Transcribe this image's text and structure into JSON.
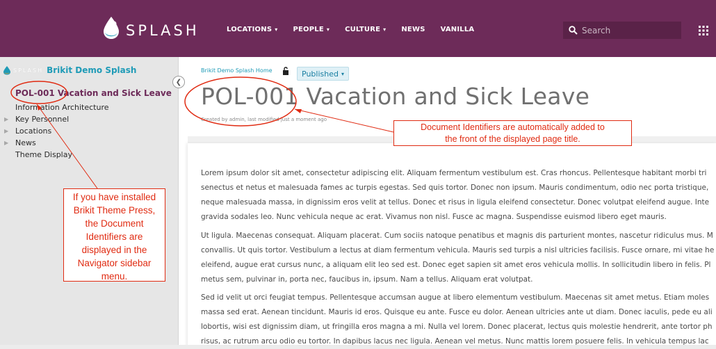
{
  "header": {
    "brand": "SPLASH",
    "nav": [
      {
        "label": "LOCATIONS",
        "dropdown": true
      },
      {
        "label": "PEOPLE",
        "dropdown": true
      },
      {
        "label": "CULTURE",
        "dropdown": true
      },
      {
        "label": "NEWS",
        "dropdown": false
      },
      {
        "label": "VANILLA",
        "dropdown": false
      }
    ],
    "search_placeholder": "Search"
  },
  "sidebar": {
    "mini_brand": "SPLASH",
    "site_name": "Brikit Demo Splash",
    "items": [
      {
        "label": "POL-001 Vacation and Sick Leave",
        "current": true,
        "expandable": false
      },
      {
        "label": "Information Architecture",
        "current": false,
        "expandable": false
      },
      {
        "label": "Key Personnel",
        "current": false,
        "expandable": true
      },
      {
        "label": "Locations",
        "current": false,
        "expandable": true
      },
      {
        "label": "News",
        "current": false,
        "expandable": true
      },
      {
        "label": "Theme Display",
        "current": false,
        "expandable": false
      }
    ]
  },
  "page": {
    "breadcrumb": "Brikit Demo Splash Home",
    "status": "Published",
    "title": "POL-001 Vacation and Sick Leave",
    "modified": "Created by admin, last modified just a moment ago",
    "paragraphs": [
      [
        "Lorem ipsum dolor sit amet, consectetur adipiscing elit. Aliquam fermentum vestibulum est. Cras rhoncus. Pellentesque habitant morbi tri",
        "senectus et netus et malesuada fames ac turpis egestas. Sed quis tortor. Donec non ipsum. Mauris condimentum, odio nec porta tristique,",
        "neque malesuada massa, in dignissim eros velit at tellus. Donec et risus in ligula eleifend consectetur. Donec volutpat eleifend augue. Inte",
        "gravida sodales leo. Nunc vehicula neque ac erat. Vivamus non nisl. Fusce ac magna. Suspendisse euismod libero eget mauris."
      ],
      [
        "Ut ligula. Maecenas consequat. Aliquam placerat. Cum sociis natoque penatibus et magnis dis parturient montes, nascetur ridiculus mus. M",
        "convallis. Ut quis tortor. Vestibulum a lectus at diam fermentum vehicula. Mauris sed turpis a nisl ultricies facilisis. Fusce ornare, mi vitae he",
        "eleifend, augue erat cursus nunc, a aliquam elit leo sed est. Donec eget sapien sit amet eros vehicula mollis. In sollicitudin libero in felis. Pl",
        "metus sem, pulvinar in, porta nec, faucibus in, ipsum. Nam a tellus. Aliquam erat volutpat."
      ],
      [
        "Sed id velit ut orci feugiat tempus. Pellentesque accumsan augue at libero elementum vestibulum. Maecenas sit amet metus. Etiam moles",
        "massa sed erat. Aenean tincidunt. Mauris id eros. Quisque eu ante. Fusce eu dolor. Aenean ultricies ante ut diam. Donec iaculis, pede eu ali",
        "lobortis, wisi est dignissim diam, ut fringilla eros magna a mi. Nulla vel lorem. Donec placerat, lectus quis molestie hendrerit, ante tortor ph",
        "risus, ac rutrum arcu odio eu tortor. In dapibus lacus nec ligula. Aenean vel metus. Nunc mattis lorem posuere felis. In vehicula tempus lac"
      ]
    ]
  },
  "annotations": {
    "title_note": [
      "Document Identifiers are automatically added to",
      "the front of the displayed page title."
    ],
    "sidebar_note": [
      "If you have installed",
      "Brikit Theme Press,",
      "the Document",
      "Identifiers are",
      "displayed in the",
      "Navigator sidebar",
      "menu."
    ],
    "color": "#e02b12"
  },
  "colors": {
    "header_bg": "#6d2b59",
    "accent": "#1f9bb7",
    "annotation": "#e02b12"
  }
}
